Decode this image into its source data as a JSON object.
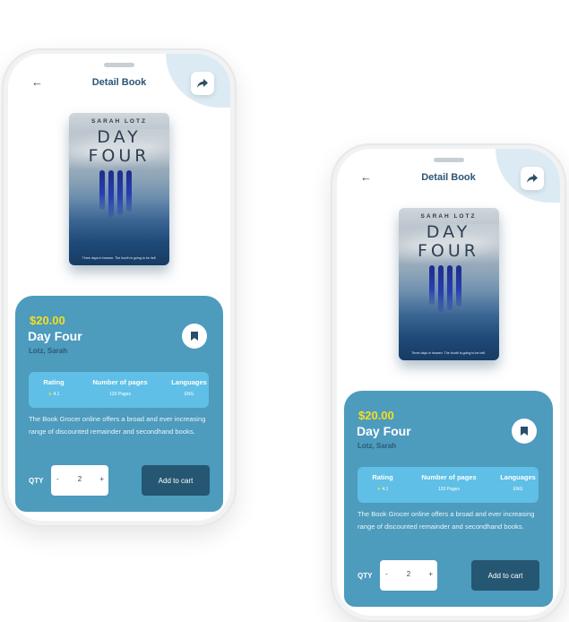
{
  "header": {
    "back_label": "←",
    "title": "Detail Book"
  },
  "cover": {
    "author": "SARAH LOTZ",
    "title_line1": "DAY",
    "title_line2": "FOUR",
    "tagline": "Three days in heaven. The fourth is going to be hell."
  },
  "book": {
    "price": "$20.00",
    "title": "Day Four",
    "author": "Lotz, Sarah",
    "description": "The Book Grocer online offers a broad and ever increasing range of discounted remainder and secondhand books."
  },
  "info": {
    "rating_label": "Rating",
    "rating_star": "★",
    "rating_value": "4.1",
    "pages_label": "Number of pages",
    "pages_value": "120 Pages",
    "languages_label": "Languages",
    "languages_value": "ENG"
  },
  "purchase": {
    "qty_label": "QTY",
    "minus": "-",
    "qty_value": "2",
    "plus": "+",
    "add_to_cart": "Add to cart"
  },
  "colors": {
    "card": "#4d9bbd",
    "info_panel": "#5fbfe6",
    "price": "#f7df1e",
    "button": "#255772",
    "heading": "#2b5576"
  },
  "icons": [
    "back-arrow-icon",
    "share-icon",
    "bookmark-icon",
    "star-icon"
  ]
}
